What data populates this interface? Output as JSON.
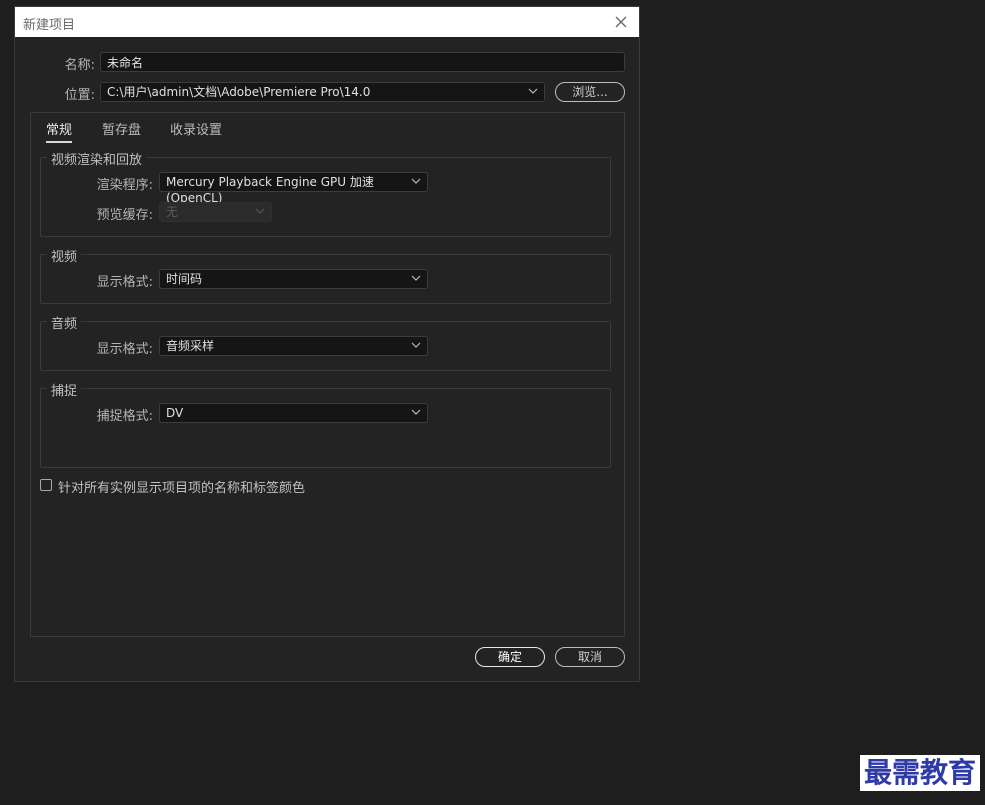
{
  "dialog": {
    "title": "新建项目"
  },
  "fields": {
    "name_label": "名称:",
    "name_value": "未命名",
    "location_label": "位置:",
    "location_value": "C:\\用户\\admin\\文档\\Adobe\\Premiere Pro\\14.0",
    "browse_label": "浏览..."
  },
  "tabs": [
    {
      "label": "常规",
      "active": true
    },
    {
      "label": "暂存盘",
      "active": false
    },
    {
      "label": "收录设置",
      "active": false
    }
  ],
  "groups": {
    "render": {
      "title": "视频渲染和回放",
      "renderer_label": "渲染程序:",
      "renderer_value": "Mercury Playback Engine GPU 加速 (OpenCL)",
      "preview_cache_label": "预览缓存:",
      "preview_cache_value": "无"
    },
    "video": {
      "title": "视频",
      "display_format_label": "显示格式:",
      "display_format_value": "时间码"
    },
    "audio": {
      "title": "音频",
      "display_format_label": "显示格式:",
      "display_format_value": "音频采样"
    },
    "capture": {
      "title": "捕捉",
      "capture_format_label": "捕捉格式:",
      "capture_format_value": "DV"
    }
  },
  "checkbox": {
    "label": "针对所有实例显示项目项的名称和标签颜色",
    "checked": false
  },
  "footer": {
    "ok_label": "确定",
    "cancel_label": "取消"
  },
  "watermark": "最需教育",
  "icons": {
    "close": "close-icon",
    "chevron": "chevron-down-icon"
  }
}
